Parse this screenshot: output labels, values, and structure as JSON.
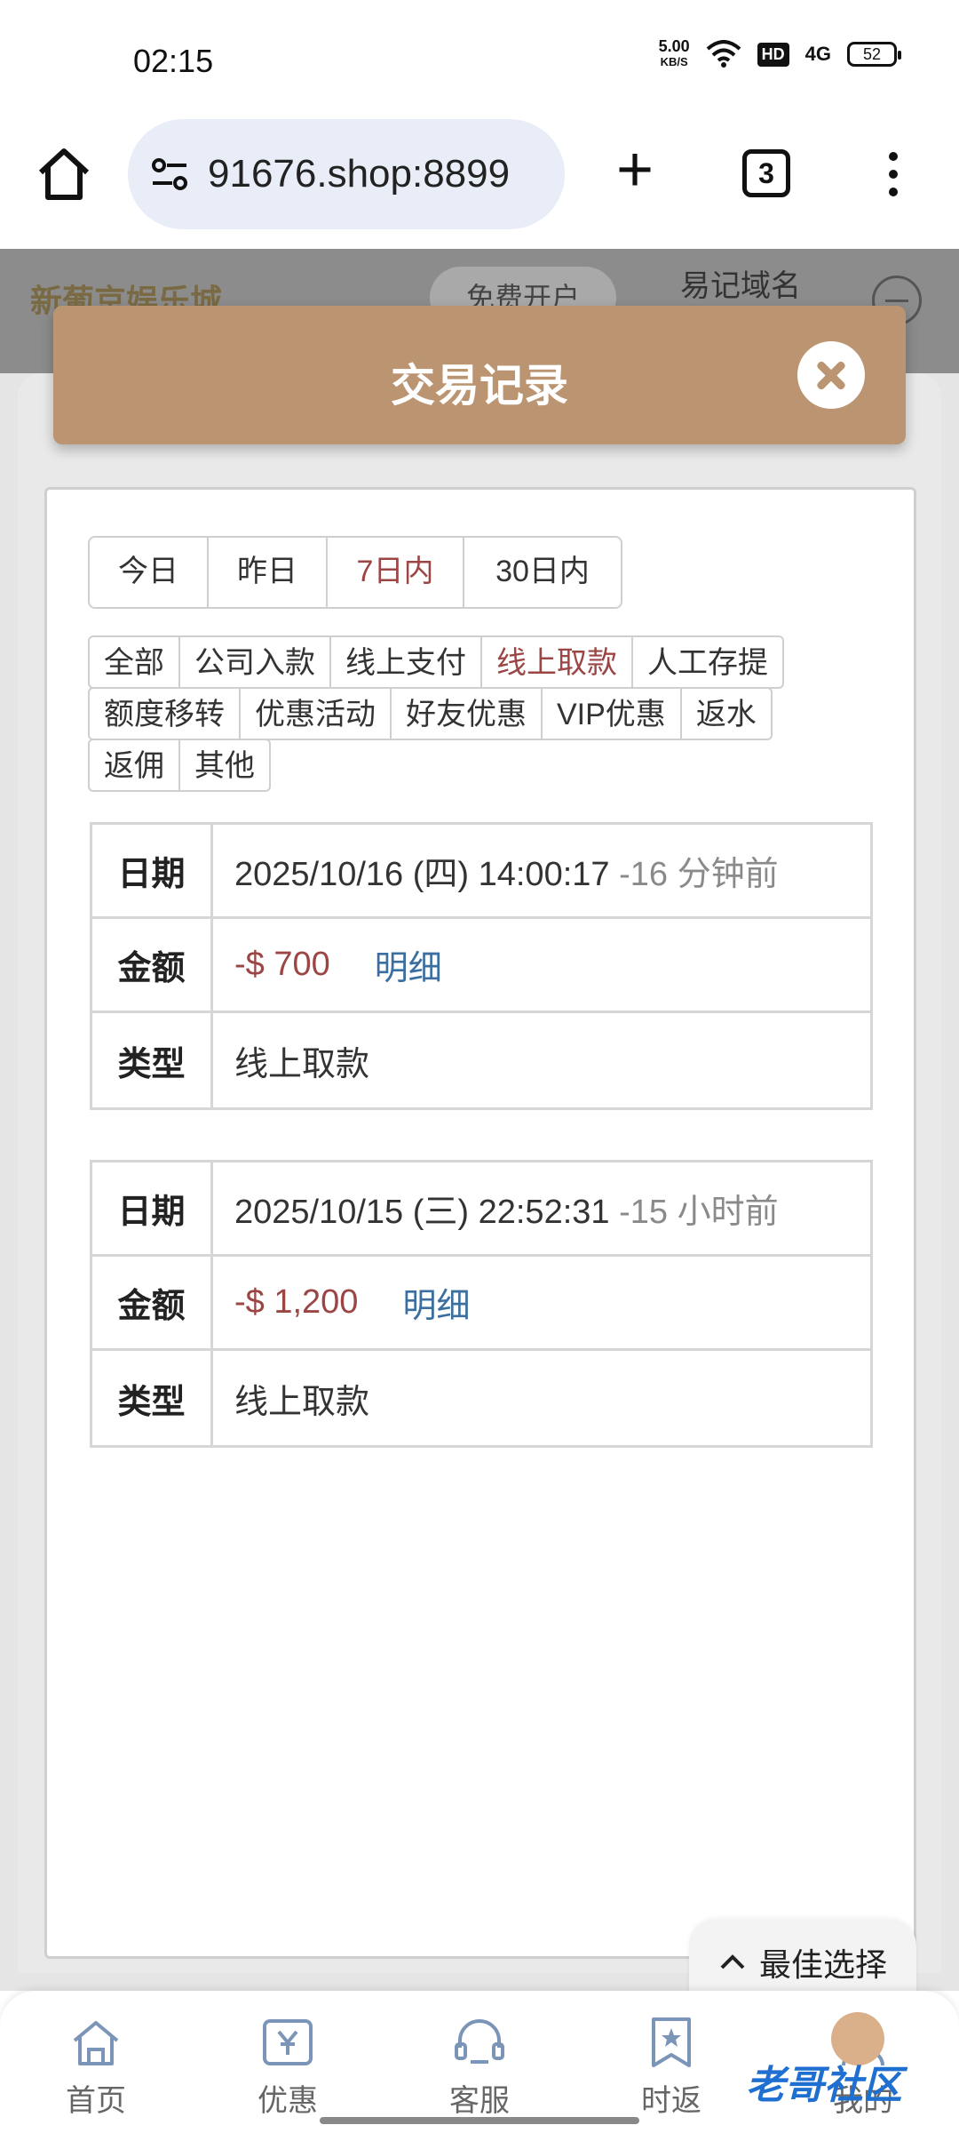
{
  "status": {
    "time": "02:15",
    "speed_value": "5.00",
    "speed_unit": "KB/S",
    "hd": "HD",
    "signal": "4G",
    "battery": "52"
  },
  "browser": {
    "url": "91676.shop:8899",
    "tab_count": "3"
  },
  "page": {
    "brand": "新葡京娱乐城",
    "free_open": "免费开户",
    "domain_note": "易记域名"
  },
  "modal": {
    "title": "交易记录"
  },
  "ranges": [
    {
      "label": "今日",
      "active": false
    },
    {
      "label": "昨日",
      "active": false
    },
    {
      "label": "7日内",
      "active": true
    },
    {
      "label": "30日内",
      "active": false
    }
  ],
  "filters": {
    "row1": [
      "全部",
      "公司入款",
      "线上支付",
      "线上取款",
      "人工存提"
    ],
    "row2": [
      "额度移转",
      "优惠活动",
      "好友优惠",
      "VIP优惠",
      "返水"
    ],
    "row3": [
      "返佣",
      "其他"
    ],
    "active": "线上取款"
  },
  "labels": {
    "date": "日期",
    "amount": "金额",
    "type": "类型",
    "detail": "明细"
  },
  "records": [
    {
      "date": "2025/10/16 (四) 14:00:17",
      "ago": "-16 分钟前",
      "amount": "-$ 700",
      "type": "线上取款"
    },
    {
      "date": "2025/10/15 (三) 22:52:31",
      "ago": "-15 小时前",
      "amount": "-$ 1,200",
      "type": "线上取款"
    }
  ],
  "best_choice": "最佳选择",
  "nav": [
    {
      "label": "首页",
      "icon": "home-icon"
    },
    {
      "label": "优惠",
      "icon": "coupon-icon"
    },
    {
      "label": "客服",
      "icon": "headset-icon"
    },
    {
      "label": "时返",
      "icon": "bookmark-star-icon"
    },
    {
      "label": "我的",
      "icon": "user-icon"
    }
  ],
  "watermark": "老哥社区",
  "colors": {
    "header_brown": "#bb9572",
    "active_red": "#9c4545",
    "link_blue": "#3b6fa0"
  }
}
